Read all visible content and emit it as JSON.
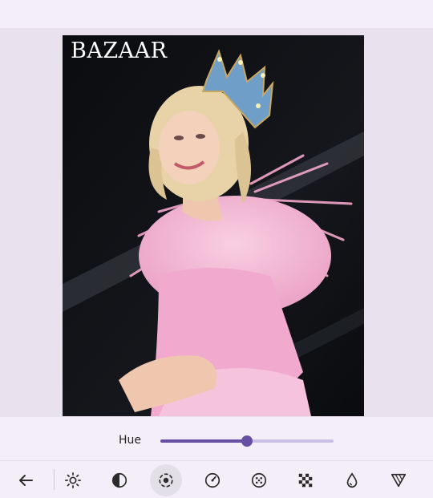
{
  "photo": {
    "brand": "BAZAAR",
    "colors": {
      "background": "#0c0d10",
      "dress": "#f3b7d4",
      "hair": "#ead8b0",
      "crown": "#6f9fc8"
    }
  },
  "adjust": {
    "label": "Hue",
    "value_fraction": 0.5
  },
  "toolbar": {
    "items": [
      {
        "icon": "back-arrow-icon"
      },
      {
        "icon": "brightness-icon"
      },
      {
        "icon": "contrast-icon"
      },
      {
        "icon": "hue-icon",
        "selected": true
      },
      {
        "icon": "saturation-gauge-icon"
      },
      {
        "icon": "sharpen-dots-icon"
      },
      {
        "icon": "grain-checker-icon"
      },
      {
        "icon": "warmth-drop-icon"
      },
      {
        "icon": "vignette-triangle-icon"
      }
    ]
  },
  "colors": {
    "accent": "#6750a4",
    "track": "#c9c0e6",
    "panel": "#f3eef7"
  }
}
